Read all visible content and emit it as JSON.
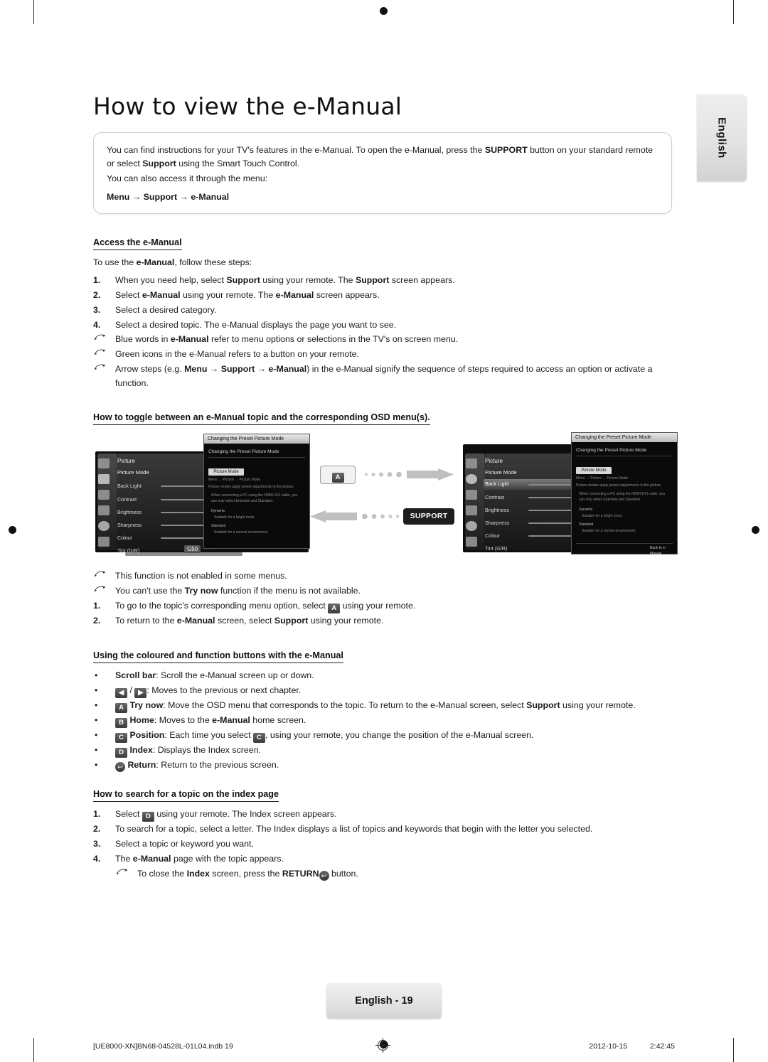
{
  "page": {
    "title": "How to view the e-Manual",
    "side_tab": "English",
    "page_badge": "English - 19",
    "footer_left": "[UE8000-XN]BN68-04528L-01L04.indb   19",
    "footer_right_date": "2012-10-15",
    "footer_right_time": "2:42:45"
  },
  "intro": {
    "line1_a": "You can find instructions for your TV's features in the e-Manual. To open the e-Manual, press the ",
    "line1_b": "SUPPORT",
    "line1_c": " button on your standard remote or select ",
    "line1_d": "Support",
    "line1_e": " using the Smart Touch Control.",
    "line2": "You can also access it through the menu:",
    "menu_path": "Menu → Support → e-Manual"
  },
  "section_access": {
    "heading": "Access the e-Manual",
    "lead_a": "To use the ",
    "lead_b": "e-Manual",
    "lead_c": ", follow these steps:",
    "steps": [
      {
        "num": "1.",
        "parts": [
          {
            "t": "When you need help, select ",
            "b": false
          },
          {
            "t": "Support",
            "b": true
          },
          {
            "t": " using your remote. The ",
            "b": false
          },
          {
            "t": "Support",
            "b": true
          },
          {
            "t": " screen appears.",
            "b": false
          }
        ]
      },
      {
        "num": "2.",
        "parts": [
          {
            "t": "Select ",
            "b": false
          },
          {
            "t": "e-Manual",
            "b": true
          },
          {
            "t": " using your remote. The ",
            "b": false
          },
          {
            "t": "e-Manual",
            "b": true
          },
          {
            "t": " screen appears.",
            "b": false
          }
        ]
      },
      {
        "num": "3.",
        "parts": [
          {
            "t": "Select a desired category.",
            "b": false
          }
        ]
      },
      {
        "num": "4.",
        "parts": [
          {
            "t": "Select a desired topic. The e-Manual displays the page you want to see.",
            "b": false
          }
        ]
      }
    ],
    "notes": [
      {
        "parts": [
          {
            "t": "Blue words in ",
            "b": false
          },
          {
            "t": "e-Manual",
            "b": true
          },
          {
            "t": " refer to menu options or selections in the TV's on screen menu.",
            "b": false
          }
        ]
      },
      {
        "parts": [
          {
            "t": "Green icons in the e-Manual refers to a button on your remote.",
            "b": false
          }
        ]
      },
      {
        "parts": [
          {
            "t": "Arrow steps (e.g. ",
            "b": false
          },
          {
            "t": "Menu → Support → e-Manual",
            "b": true
          },
          {
            "t": ") in the e-Manual signify the sequence of steps required to access an option or activate a function.",
            "b": false
          }
        ]
      }
    ]
  },
  "section_toggle": {
    "heading": "How to toggle between an e-Manual topic and the corresponding OSD menu(s).",
    "figure": {
      "osd_title": "Picture",
      "osd_subtitle": "Picture Mode",
      "osd_rows": [
        "Back Light",
        "Contrast",
        "Brightness",
        "Sharpness",
        "Colour",
        "Tint (G/R)"
      ],
      "osd_value": "G50",
      "emanual_title": "Changing the Preset Picture Mode",
      "emanual_head": "Changing the Preset Picture Mode",
      "emanual_section": "Picture Mode",
      "emanual_sub": "Menu → Picture → Picture Mode",
      "emanual_body1": "Picture modes apply preset adjustments to the picture.",
      "emanual_body2": "When connecting a PC using the HDMI-DVI cable, you can only select Entertain and Standard.",
      "emanual_li1": "Dynamic",
      "emanual_li1_d": "Suitable for a bright room.",
      "emanual_li2": "Standard",
      "emanual_li2_d": "Suitable for a normal environment.",
      "emanual_footer": "Back to e-Manual",
      "a_key": "A",
      "support_label": "SUPPORT"
    },
    "notes": [
      {
        "parts": [
          {
            "t": "This function is not enabled in some menus.",
            "b": false
          }
        ]
      },
      {
        "parts": [
          {
            "t": "You can't use the ",
            "b": false
          },
          {
            "t": "Try now",
            "b": true
          },
          {
            "t": " function if the menu is not available.",
            "b": false
          }
        ]
      }
    ],
    "steps": [
      {
        "num": "1.",
        "parts_pre": "To go to the topic's corresponding menu option, select ",
        "key": "A",
        "parts_post": " using your remote."
      },
      {
        "num": "2.",
        "parts_pre": "To return to the ",
        "bold1": "e-Manual",
        "mid": " screen, select ",
        "bold2": "Support",
        "parts_post": " using your remote."
      }
    ]
  },
  "section_buttons": {
    "heading": "Using the coloured and function buttons with the e-Manual",
    "items": [
      {
        "icon": "none",
        "parts": [
          {
            "t": "Scroll bar",
            "b": true
          },
          {
            "t": ": Scroll the e-Manual screen up or down.",
            "b": false
          }
        ]
      },
      {
        "icon": "arrows",
        "parts": [
          {
            "t": ": Moves to the previous or next chapter.",
            "b": false
          }
        ]
      },
      {
        "icon": "a",
        "parts": [
          {
            "t": "Try now",
            "b": true
          },
          {
            "t": ": Move the OSD menu that corresponds to the topic. To return to the e-Manual screen, select ",
            "b": false
          },
          {
            "t": "Support",
            "b": true
          },
          {
            "t": " using your remote.",
            "b": false
          }
        ]
      },
      {
        "icon": "b",
        "parts": [
          {
            "t": "Home",
            "b": true
          },
          {
            "t": ": Moves to the ",
            "b": false
          },
          {
            "t": "e-Manual",
            "b": true
          },
          {
            "t": " home screen.",
            "b": false
          }
        ]
      },
      {
        "icon": "c",
        "parts": [
          {
            "t": "Position",
            "b": true
          },
          {
            "t": ": Each time you select ",
            "b": false
          }
        ],
        "mid_icon": "c",
        "tail": ", using your remote, you change the position of the e-Manual screen."
      },
      {
        "icon": "d",
        "parts": [
          {
            "t": "Index",
            "b": true
          },
          {
            "t": ": Displays the Index screen.",
            "b": false
          }
        ]
      },
      {
        "icon": "return",
        "parts": [
          {
            "t": "Return",
            "b": true
          },
          {
            "t": ": Return to the previous screen.",
            "b": false
          }
        ]
      }
    ]
  },
  "section_index": {
    "heading": "How to search for a topic on the index page",
    "steps": [
      {
        "num": "1.",
        "pre": "Select ",
        "key": "D",
        "post": " using your remote. The Index screen appears."
      },
      {
        "num": "2.",
        "pre": "To search for a topic, select a letter. The Index displays a list of topics and keywords that begin with the letter you selected.",
        "key": "",
        "post": ""
      },
      {
        "num": "3.",
        "pre": "Select a topic or keyword you want.",
        "key": "",
        "post": ""
      },
      {
        "num": "4.",
        "pre": "The ",
        "bold": "e-Manual",
        "post": " page with the topic appears."
      }
    ],
    "note": {
      "pre": "To close the ",
      "bold1": "Index",
      "mid": " screen, press the ",
      "bold2": "RETURN",
      "post": " button."
    }
  }
}
